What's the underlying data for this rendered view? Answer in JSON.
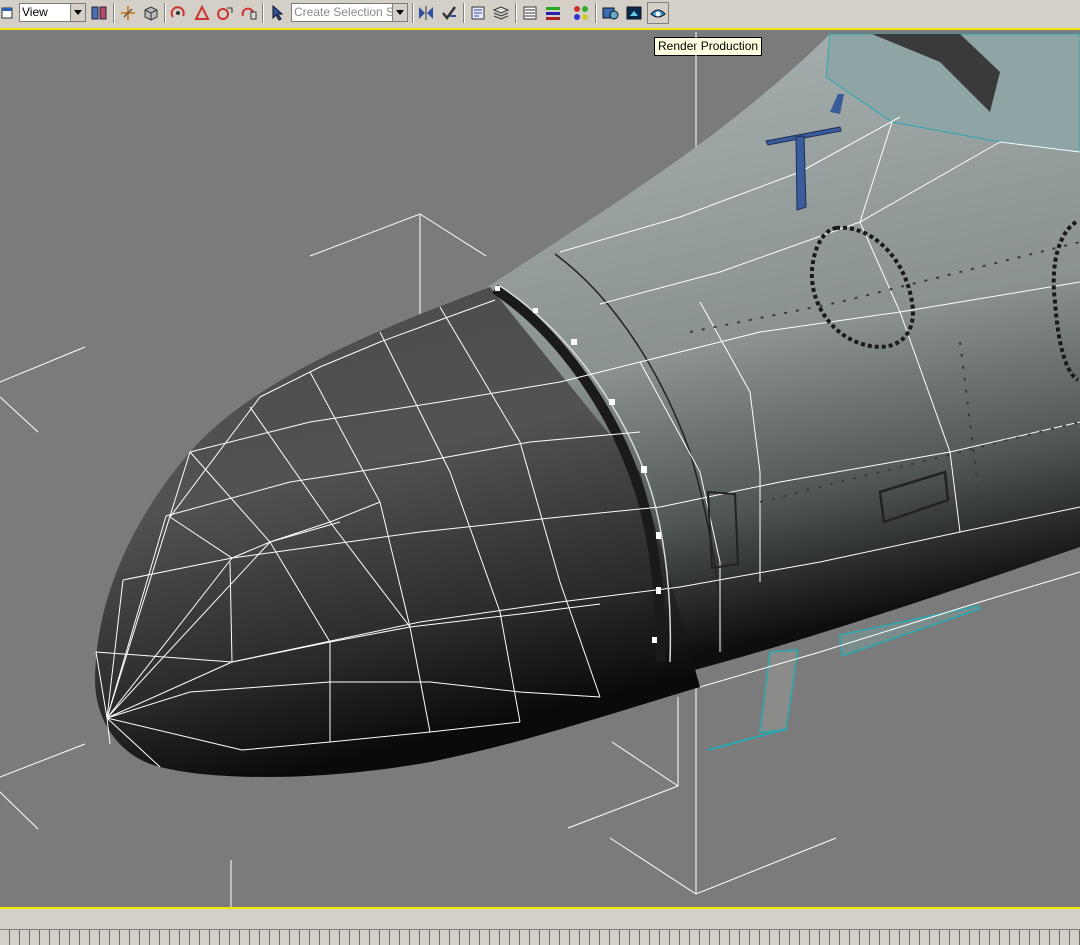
{
  "toolbar": {
    "view_dropdown": "View",
    "selection_set_placeholder": "Create Selection Set",
    "icons": [
      "viewport-toggle-icon",
      "select-filter-icon",
      "move-icon",
      "bind-icon",
      "rotate-icon",
      "scale-icon",
      "uniform-scale-icon",
      "squash-icon",
      "select-manipulate-icon",
      "mirror-icon",
      "align-icon",
      "layer-icon",
      "named-selection-icon",
      "curve-editor-icon",
      "schematic-view-icon",
      "material-editor-icon",
      "render-setup-icon",
      "rendered-frame-icon",
      "render-production-icon"
    ]
  },
  "tooltip": {
    "text": "Render Production"
  },
  "viewport": {
    "border_color": "#f0e60a",
    "background": "#7b7b7b"
  }
}
